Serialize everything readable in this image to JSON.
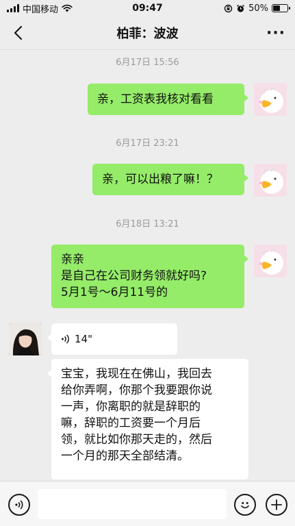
{
  "status_bar": {
    "carrier": "中国移动",
    "time": "09:47",
    "battery": "50%",
    "battery_level": 0.5
  },
  "nav": {
    "title": "柏菲：波波",
    "more_label": "···"
  },
  "messages": [
    {
      "timestamp": "6月17日 15:56",
      "lines": [
        "亲，工资表我核对看看"
      ]
    },
    {
      "timestamp": "6月17日 23:21",
      "lines": [
        "亲，可以出粮了嘛！？"
      ]
    },
    {
      "timestamp": "6月18日 13:21",
      "lines": [
        "亲亲",
        "是自己在公司财务领就好吗?",
        "5月1号～6月11号的"
      ]
    }
  ],
  "incoming": {
    "voice_duration": "14\"",
    "text_lines": [
      "宝宝，我现在在佛山，我回去",
      "给你弄啊，你那个我要跟你说",
      "一声，你离职的就是辞职的",
      "嘛，辞职的工资要一个月后",
      "领，就比如你那天走的，然后",
      "一个月的那天全部结清。"
    ]
  },
  "colors": {
    "sent_bubble": "#95ec69",
    "received_bubble": "#ffffff",
    "background": "#ededed"
  },
  "icons": {
    "back": "chevron-left-icon",
    "more": "more-dots-icon",
    "voice_mode": "voice-icon",
    "emoji": "smiley-icon",
    "add": "plus-icon"
  }
}
